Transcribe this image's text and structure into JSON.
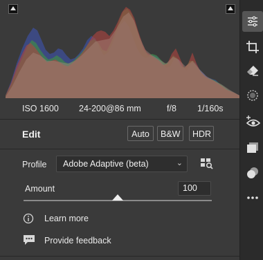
{
  "camera_info": {
    "iso": "ISO 1600",
    "lens": "24-200@86 mm",
    "aperture": "f/8",
    "shutter": "1/160s"
  },
  "edit": {
    "title": "Edit",
    "auto_label": "Auto",
    "bw_label": "B&W",
    "hdr_label": "HDR"
  },
  "profile": {
    "label": "Profile",
    "selected": "Adobe Adaptive (beta)"
  },
  "amount": {
    "label": "Amount",
    "value": "100",
    "slider_position_fraction": 0.5
  },
  "links": {
    "learn_more": "Learn more",
    "feedback": "Provide feedback"
  },
  "toolbar": {
    "tools": [
      "sliders-icon",
      "crop-icon",
      "eraser-icon",
      "masking-icon",
      "red-eye-icon",
      "presets-icon",
      "snapshots-icon",
      "more-icon"
    ],
    "active_tool": "sliders-icon"
  },
  "colors": {
    "panel_bg": "#3a3a3a",
    "toolbar_bg": "#2b2b2b",
    "histogram_red": "#b0443f",
    "histogram_green": "#3f8a4a",
    "histogram_blue": "#3d4f9a",
    "histogram_luma": "#a8877c"
  }
}
